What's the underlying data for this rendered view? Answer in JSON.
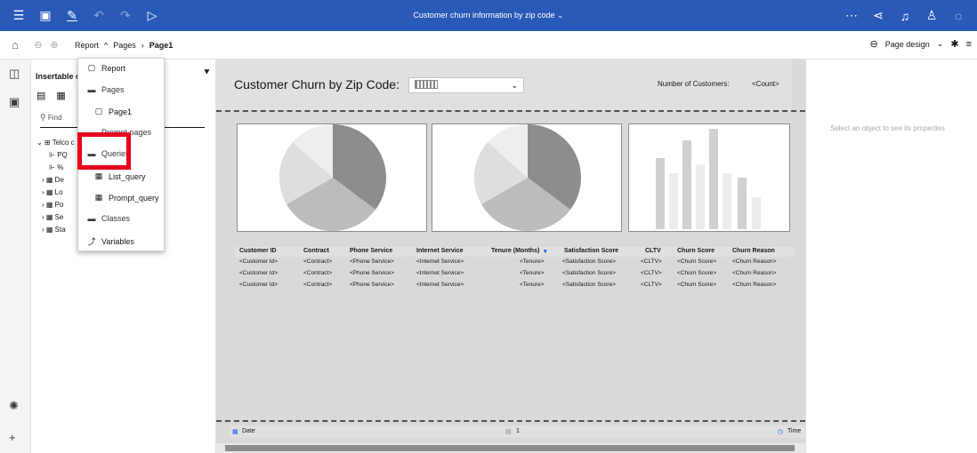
{
  "app": {
    "title": "Customer churn information by zip code"
  },
  "breadcrumb": {
    "report": "Report",
    "pages": "Pages",
    "current": "Page1"
  },
  "right_toolbar": {
    "page_design": "Page design"
  },
  "left_panel": {
    "header": "Insertable o",
    "find_placeholder": "Find",
    "tree": [
      "Telco c",
      "PQ",
      "%",
      "De",
      "Lo",
      "Po",
      "Se",
      "Sta"
    ]
  },
  "menu": {
    "items": [
      {
        "label": "Report",
        "icon": "document-icon"
      },
      {
        "label": "Pages",
        "icon": "folder-icon"
      },
      {
        "label": "Page1",
        "icon": "page-icon"
      },
      {
        "label": "Prompt pages",
        "icon": "folder-icon"
      },
      {
        "label": "Queries",
        "icon": "folder-icon"
      },
      {
        "label": "List_query",
        "icon": "query-icon"
      },
      {
        "label": "Prompt_query",
        "icon": "query-icon"
      },
      {
        "label": "Classes",
        "icon": "folder-icon"
      },
      {
        "label": "Variables",
        "icon": "variables-icon"
      }
    ],
    "highlight_color": "#e8001c"
  },
  "report": {
    "title": "Customer Churn by Zip Code:",
    "number_of_customers_label": "Number of Customers:",
    "count_placeholder": "<Count>",
    "table": {
      "columns": [
        "Customer ID",
        "Contract",
        "Phone Service",
        "Internet Service",
        "Tenure (Months)",
        "Satisfaction Score",
        "CLTV",
        "Churn Score",
        "Churn Reason"
      ],
      "rows": [
        [
          "<Customer Id>",
          "<Contract>",
          "<Phone Service>",
          "<Internet Service>",
          "<Tenure>",
          "<Satisfaction Score>",
          "<CLTV>",
          "<Churn Score>",
          "<Churn Reason>"
        ],
        [
          "<Customer Id>",
          "<Contract>",
          "<Phone Service>",
          "<Internet Service>",
          "<Tenure>",
          "<Satisfaction Score>",
          "<CLTV>",
          "<Churn Score>",
          "<Churn Reason>"
        ],
        [
          "<Customer Id>",
          "<Contract>",
          "<Phone Service>",
          "<Internet Service>",
          "<Tenure>",
          "<Satisfaction Score>",
          "<CLTV>",
          "<Churn Score>",
          "<Churn Reason>"
        ]
      ]
    },
    "footer": {
      "date": "Date",
      "page": "1",
      "time": "Time"
    }
  },
  "properties_panel": {
    "message": "Select an object to see its properties"
  },
  "colors": {
    "topbar": "#2a5ab8",
    "canvas": "#d9d9d9"
  }
}
